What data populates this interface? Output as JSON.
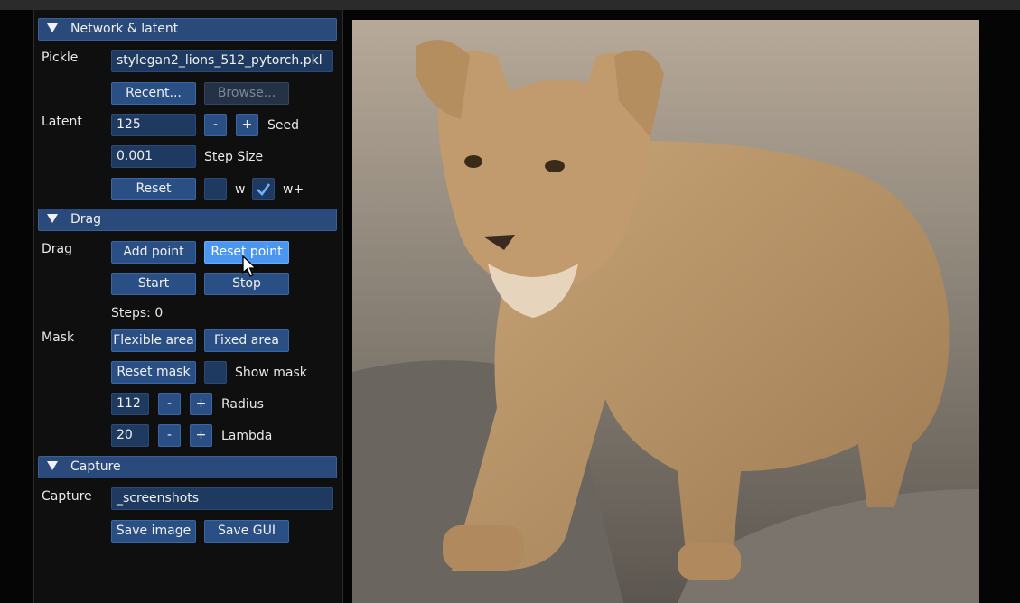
{
  "colors": {
    "panel_bg": "#0f0f10",
    "header_bg": "#294a7a",
    "button_bg": "#2a4f84",
    "button_active": "#4a96f0",
    "field_bg": "#1f3a60"
  },
  "network": {
    "title": "Network & latent",
    "pickle_label": "Pickle",
    "pickle_value": "stylegan2_lions_512_pytorch.pkl",
    "recent_btn": "Recent...",
    "browse_btn": "Browse...",
    "latent_label": "Latent",
    "seed_value": "125",
    "minus": "-",
    "plus": "+",
    "seed_label": "Seed",
    "step_value": "0.001",
    "step_label": "Step Size",
    "reset_btn": "Reset",
    "w_label": "w",
    "wplus_label": "w+",
    "w_checked": false,
    "wplus_checked": true
  },
  "drag": {
    "title": "Drag",
    "drag_label": "Drag",
    "add_point_btn": "Add point",
    "reset_point_btn": "Reset point",
    "start_btn": "Start",
    "stop_btn": "Stop",
    "steps_text": "Steps: 0",
    "mask_label": "Mask",
    "flexible_btn": "Flexible area",
    "fixed_btn": "Fixed area",
    "reset_mask_btn": "Reset mask",
    "show_mask_label": "Show mask",
    "show_mask_checked": false,
    "radius_value": "112",
    "radius_label": "Radius",
    "lambda_value": "20",
    "lambda_label": "Lambda",
    "minus": "-",
    "plus": "+"
  },
  "capture": {
    "title": "Capture",
    "capture_label": "Capture",
    "path_value": "_screenshots",
    "save_image_btn": "Save image",
    "save_gui_btn": "Save GUI"
  },
  "image": {
    "subject": "generated image of a lioness standing on rocks"
  }
}
